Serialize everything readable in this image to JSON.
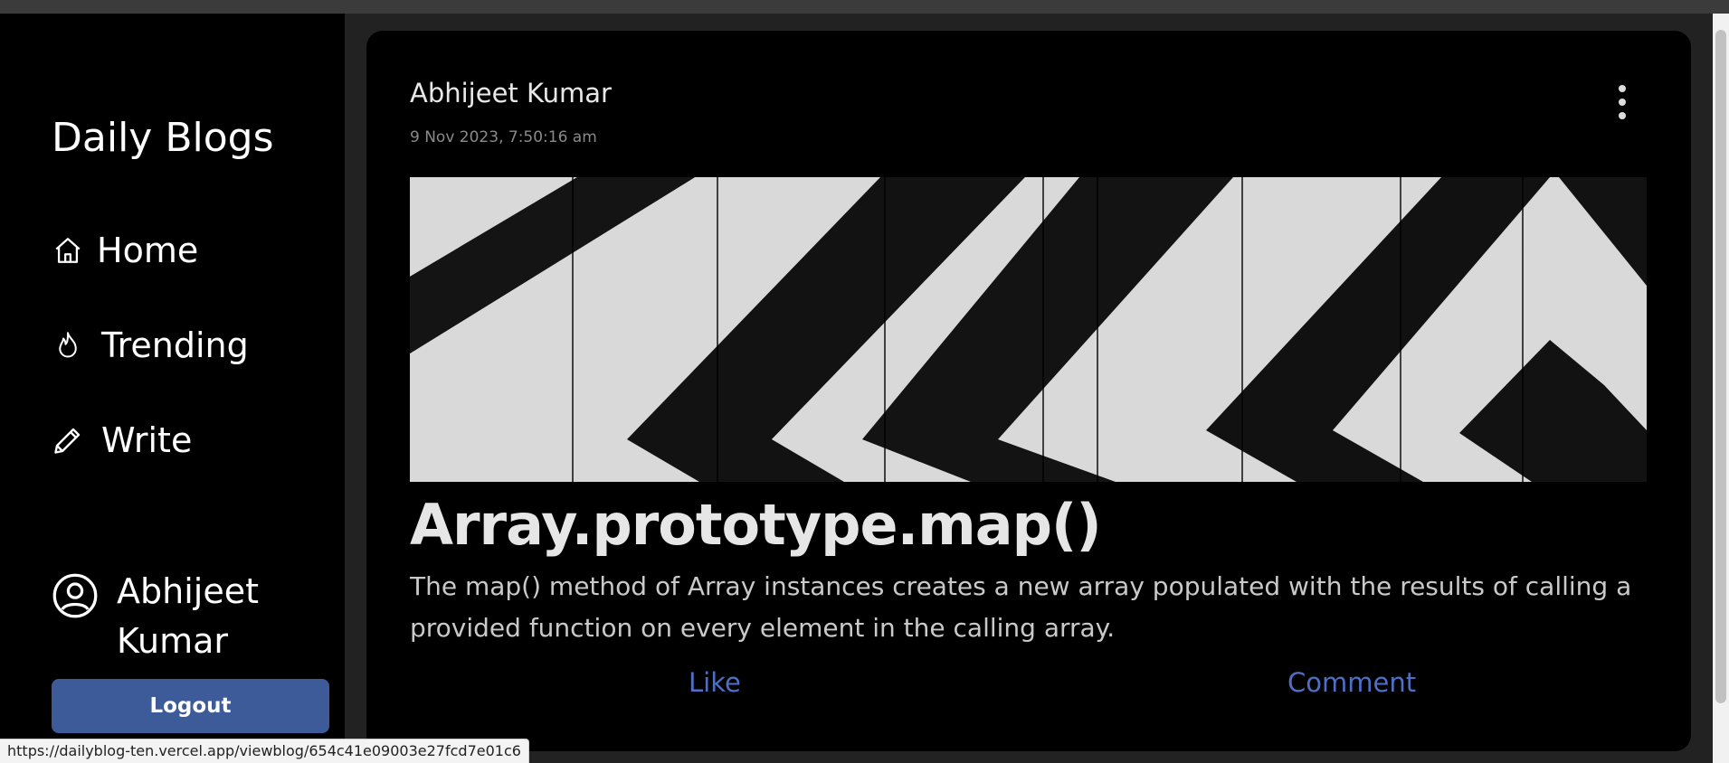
{
  "sidebar": {
    "brand": "Daily Blogs",
    "nav": [
      {
        "label": "Home",
        "icon": "home-icon"
      },
      {
        "label": "Trending",
        "icon": "flame-icon"
      },
      {
        "label": "Write",
        "icon": "pencil-icon"
      }
    ],
    "user": {
      "name": "Abhijeet Kumar",
      "icon": "user-circle-icon"
    },
    "logout_label": "Logout"
  },
  "post": {
    "author": "Abhijeet Kumar",
    "date": "9 Nov 2023, 7:50:16 am",
    "title": "Array.prototype.map()",
    "description": "The map() method of Array instances creates a new array populated with the results of calling a provided function on every element in the calling array.",
    "like_label": "Like",
    "comment_label": "Comment",
    "menu_icon": "kebab-menu-icon"
  },
  "statusbar": {
    "url": "https://dailyblog-ten.vercel.app/viewblog/654c41e09003e27fcd7e01c6"
  },
  "colors": {
    "page_bg": "#222222",
    "sidebar_bg": "#000000",
    "card_bg": "#000000",
    "accent": "#3d5a99",
    "link": "#4f6fc4"
  }
}
